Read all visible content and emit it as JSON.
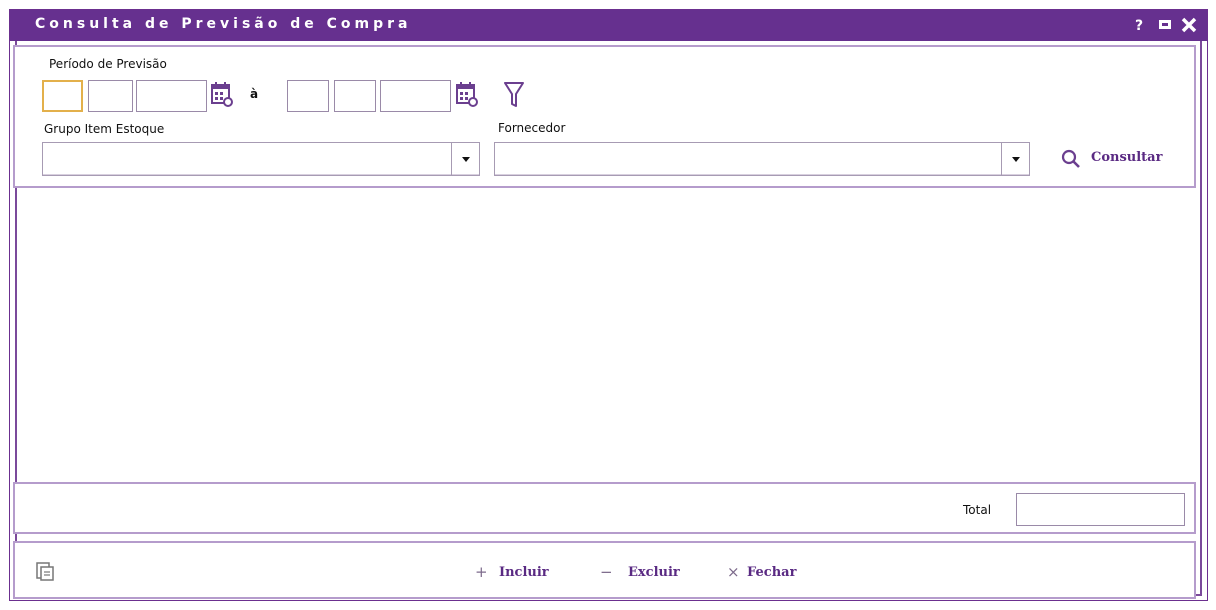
{
  "window": {
    "title": "Consulta de Previsão de Compra"
  },
  "titlebar": {
    "help_label": "?",
    "maximize_icon": "square-icon",
    "close_icon": "close-icon"
  },
  "filters": {
    "period_label": "Período de Previsão",
    "period_separator": "à",
    "group_label": "Grupo Item Estoque",
    "group_value": "",
    "supplier_label": "Fornecedor",
    "supplier_value": "",
    "consult_label": "Consultar"
  },
  "totals": {
    "label": "Total",
    "value": ""
  },
  "actions": {
    "include_symbol": "+",
    "include_label": "Incluir",
    "delete_symbol": "−",
    "delete_label": "Excluir",
    "close_symbol": "×",
    "close_label": "Fechar"
  },
  "colors": {
    "accent": "#66308f",
    "panel_border": "#b59ccc",
    "focus": "#e3b04b"
  }
}
